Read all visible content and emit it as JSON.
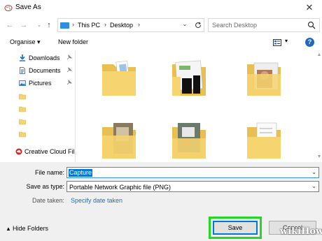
{
  "window": {
    "title": "Save As",
    "close_glyph": "✕"
  },
  "address_bar": {
    "back_glyph": "←",
    "forward_glyph": "→",
    "up_glyph": "↑",
    "breadcrumbs": [
      "This PC",
      "Desktop"
    ],
    "separator": "›",
    "search_placeholder": "Search Desktop"
  },
  "toolbar": {
    "organise": "Organise ▾",
    "new_folder": "New folder",
    "help": "?"
  },
  "navigation": {
    "items": [
      {
        "label": "Downloads",
        "icon": "download-icon"
      },
      {
        "label": "Documents",
        "icon": "documents-icon"
      },
      {
        "label": "Pictures",
        "icon": "pictures-icon"
      }
    ],
    "creative_cloud": "Creative Cloud Fil"
  },
  "files": {
    "folder_count_shown": 6
  },
  "form": {
    "file_name_label": "File name:",
    "file_name_value": "Capture",
    "save_as_type_label": "Save as type:",
    "save_as_type_value": "Portable Network Graphic file (PNG)",
    "date_taken_label": "Date taken:",
    "date_taken_link": "Specify date taken"
  },
  "footer": {
    "hide_folders": "Hide Folders",
    "save": "Save",
    "cancel": "Cancel"
  },
  "watermark": {
    "part1": "wiki",
    "part2": "How"
  },
  "colors": {
    "accent": "#0078d7",
    "highlight": "#25d825",
    "folder": "#f6d46f"
  }
}
